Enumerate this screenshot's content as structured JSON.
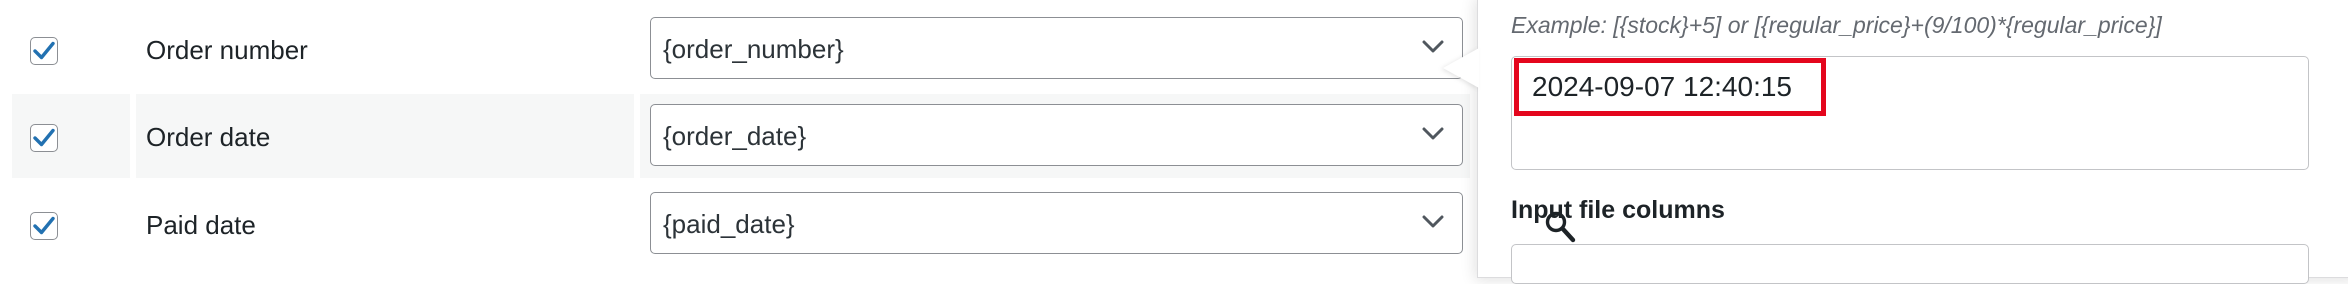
{
  "mapping_rows": [
    {
      "checked": true,
      "label": "Order number",
      "value": "{order_number}"
    },
    {
      "checked": true,
      "label": "Order date",
      "value": "{order_date}"
    },
    {
      "checked": true,
      "label": "Paid date",
      "value": "{paid_date}"
    }
  ],
  "panel": {
    "example_text": "Example: [{stock}+5] or [{regular_price}+(9/100)*{regular_price}]",
    "value_text": "2024-09-07 12:40:15",
    "section_heading": "Input file columns",
    "search_placeholder": ""
  },
  "colors": {
    "checkmark": "#2271b1",
    "highlight": "#e4061d",
    "row_alt_bg": "#f6f7f7"
  },
  "icons": {
    "checkbox_mark": "check-icon",
    "select_arrow": "chevron-down-icon",
    "cursor": "magnifier-cursor-icon"
  }
}
